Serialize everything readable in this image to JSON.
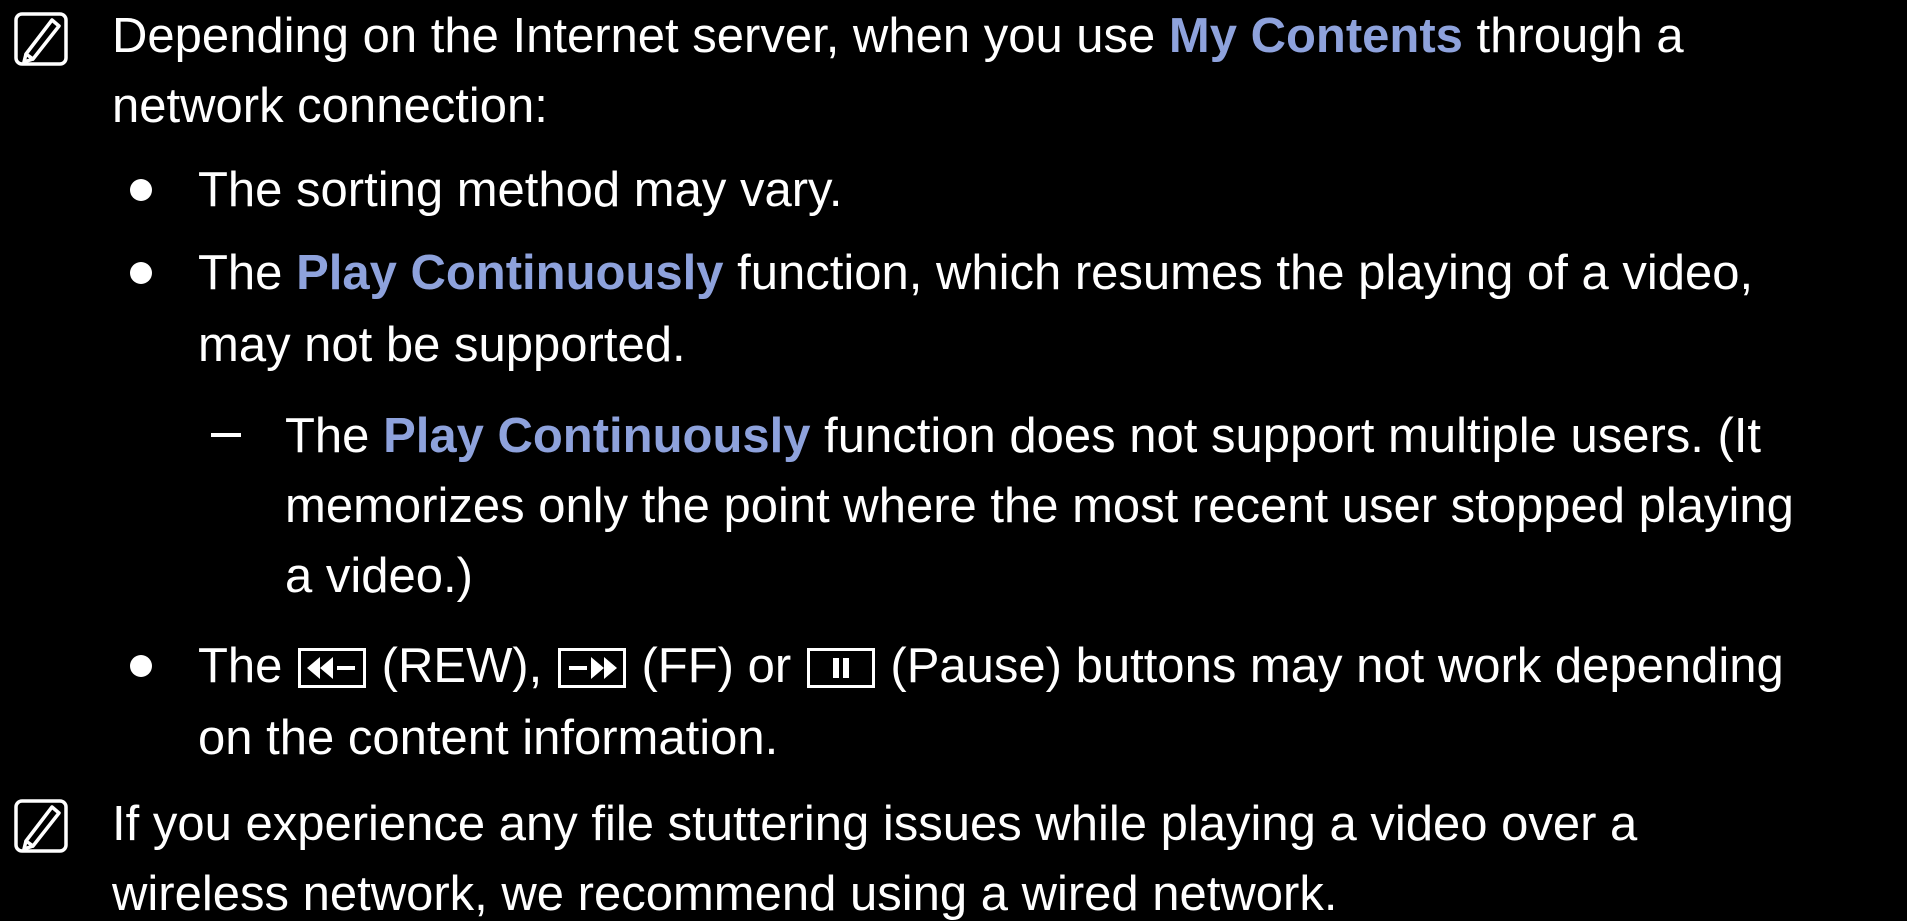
{
  "colors": {
    "background": "#000000",
    "text": "#ffffff",
    "highlight": "#8ea2dc"
  },
  "icons": {
    "note": "note-icon",
    "bullet": "bullet-icon",
    "dash": "dash-icon",
    "rew": "rewind-icon",
    "ff": "fast-forward-icon",
    "pause": "pause-icon"
  },
  "note1": {
    "pre": "Depending on the Internet server, when you use ",
    "highlight": "My Contents",
    "post": " through a",
    "line2": "network connection:"
  },
  "bullet1": {
    "text": "The sorting method may vary."
  },
  "bullet2": {
    "pre": "The ",
    "highlight": "Play Continuously",
    "post": " function, which resumes the playing of a video,",
    "line2": "may not be supported."
  },
  "subnote": {
    "pre": "The ",
    "highlight": "Play Continuously",
    "post": " function does not support multiple users. (It",
    "line2": "memorizes only the point where the most recent user stopped playing",
    "line3": "a video.)"
  },
  "bullet3": {
    "pre": "The ",
    "rew_text": " (REW), ",
    "ff_text": " (FF) or ",
    "pause_text": " (Pause) buttons may not work depending",
    "line2": "on the content information."
  },
  "note2": {
    "line1": "If you experience any file stuttering issues while playing a video over a",
    "line2": "wireless network, we recommend using a wired network."
  }
}
